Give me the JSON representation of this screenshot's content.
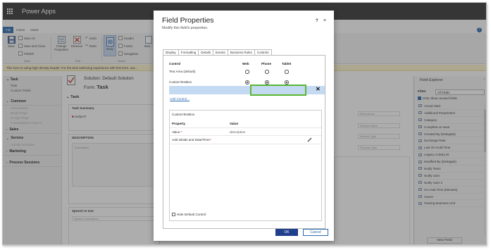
{
  "app": {
    "title": "Power Apps"
  },
  "ribbon": {
    "tabs": [
      "File",
      "Home",
      "Insert"
    ],
    "help": "?",
    "buttons": {
      "save": "Save",
      "save_as": "Save As",
      "save_close": "Save and Close",
      "publish": "Publish",
      "change_properties": "Change Properties",
      "remove": "Remove",
      "undo": "Undo",
      "redo": "Redo",
      "body": "Body",
      "header": "Header",
      "footer": "Footer",
      "navigation": "Navigation",
      "business": "Busi..."
    },
    "groups": {
      "save": "Save",
      "edit": "Edit",
      "select": "Select"
    }
  },
  "notification": "This form is using high density header. For the best authoring experience with this form, use...",
  "left_nav": {
    "task_heading": "Task",
    "task_items": [
      "Task",
      "Custom Fields"
    ],
    "common_heading": "Common",
    "common_items": [
      "Connections",
      "Email Pings",
      "In-App Pings",
      "Conversation Action It..."
    ],
    "sections": [
      "Sales",
      "Service",
      "Marketing",
      "Process Sessions"
    ],
    "service_items": [
      "Activity Incentive"
    ]
  },
  "editor": {
    "solution": "Solution: Default Solution",
    "form_label": "Form:",
    "form_name": "Task",
    "tab_title": "Task",
    "task_summary": "Task Summary",
    "subject_label": "Subject",
    "description_section": "DESCRIPTION",
    "description_placeholder": "Description",
    "speech_section": "Speech to text",
    "speech_placeholder": "Speech Description",
    "right_fields": [
      "Recurrence",
      "Review Dates",
      "Service Type",
      "Process Type"
    ]
  },
  "field_explorer": {
    "title": "Field Explorer",
    "filter_label": "Filter",
    "filter_value": "All Fields",
    "only_unused": "Only show unused fields",
    "fields": [
      "Actual Start",
      "Additional Parameters",
      "Category",
      "Complete on save",
      "Created By (Delegate)",
      "Exchange Rate",
      "Last On Hold Time",
      "Legacy Activity ID",
      "Modified By (Delegate)",
      "Notify Team",
      "Notify User",
      "Notify User 2",
      "On Hold Time (Minutes)",
      "Owner",
      "Owning Business Unit"
    ],
    "new_field": "New Field"
  },
  "dialog": {
    "title": "Field Properties",
    "subtitle": "Modify this field's properties.",
    "help": "?",
    "close": "×",
    "tabs": [
      "Display",
      "Formatting",
      "Details",
      "Events",
      "Business Rules",
      "Controls"
    ],
    "active_tab": "Controls",
    "controls_table": {
      "headers": {
        "control": "Control",
        "web": "Web",
        "phone": "Phone",
        "tablet": "Tablet"
      },
      "rows": [
        {
          "name": "Text Area (default)",
          "web": false,
          "phone": false,
          "tablet": false
        },
        {
          "name": "CustomTextBox",
          "web": true,
          "phone": true,
          "tablet": true
        }
      ],
      "delete": "✕",
      "add_control": "Add Control..."
    },
    "properties": {
      "title": "CustomTextBox",
      "headers": {
        "property": "Property",
        "value": "Value"
      },
      "rows": [
        {
          "name": "Value",
          "required": "*",
          "value": "description"
        },
        {
          "name": "Add Initials and Date/Time",
          "required": "*",
          "value": ""
        }
      ],
      "hide_default": "Hide Default Control"
    },
    "ok": "OK",
    "cancel": "Cancel"
  }
}
